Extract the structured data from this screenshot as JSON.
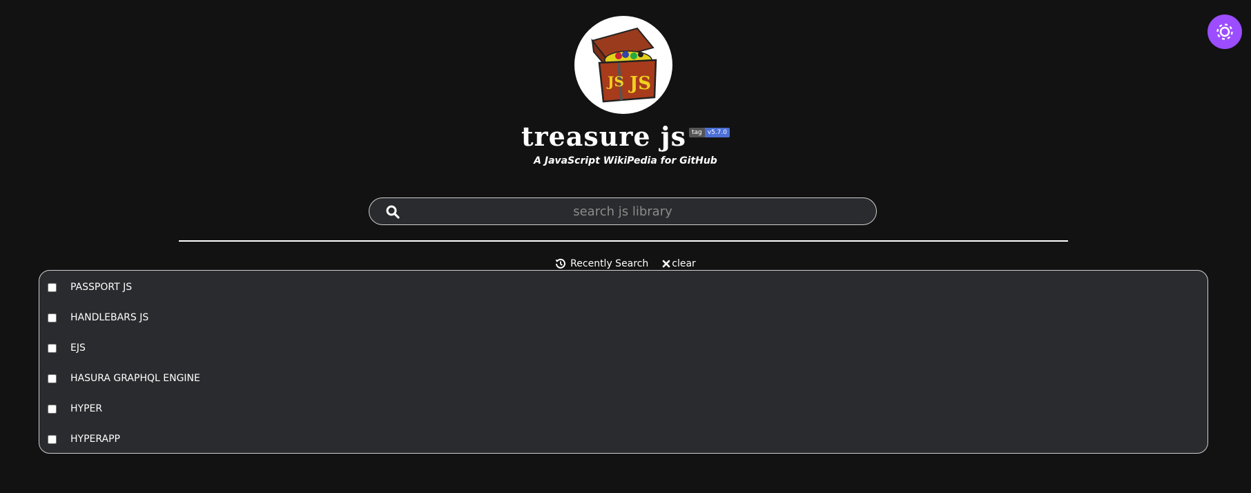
{
  "header": {
    "title": "treasure js",
    "badge_label": "tag",
    "badge_value": "v5.7.0",
    "subtitle": "A JavaScript WikiPedia for GitHub"
  },
  "search": {
    "placeholder": "search js library",
    "value": ""
  },
  "recent": {
    "label": "Recently Search",
    "clear_label": "clear"
  },
  "libraries": [
    {
      "label": "PASSPORT JS",
      "checked": false
    },
    {
      "label": "HANDLEBARS JS",
      "checked": false
    },
    {
      "label": "EJS",
      "checked": false
    },
    {
      "label": "HASURA GRAPHQL ENGINE",
      "checked": false
    },
    {
      "label": "HYPER",
      "checked": false
    },
    {
      "label": "HYPERAPP",
      "checked": false
    }
  ],
  "icons": {
    "theme_toggle": "sun-icon",
    "search": "search-icon",
    "history": "history-icon",
    "clear": "close-icon",
    "logo": "treasure-chest-logo"
  },
  "colors": {
    "background": "#121212",
    "panel": "#2a2b2e",
    "accent": "#9b4dff",
    "badge_version": "#4c6fd6"
  }
}
